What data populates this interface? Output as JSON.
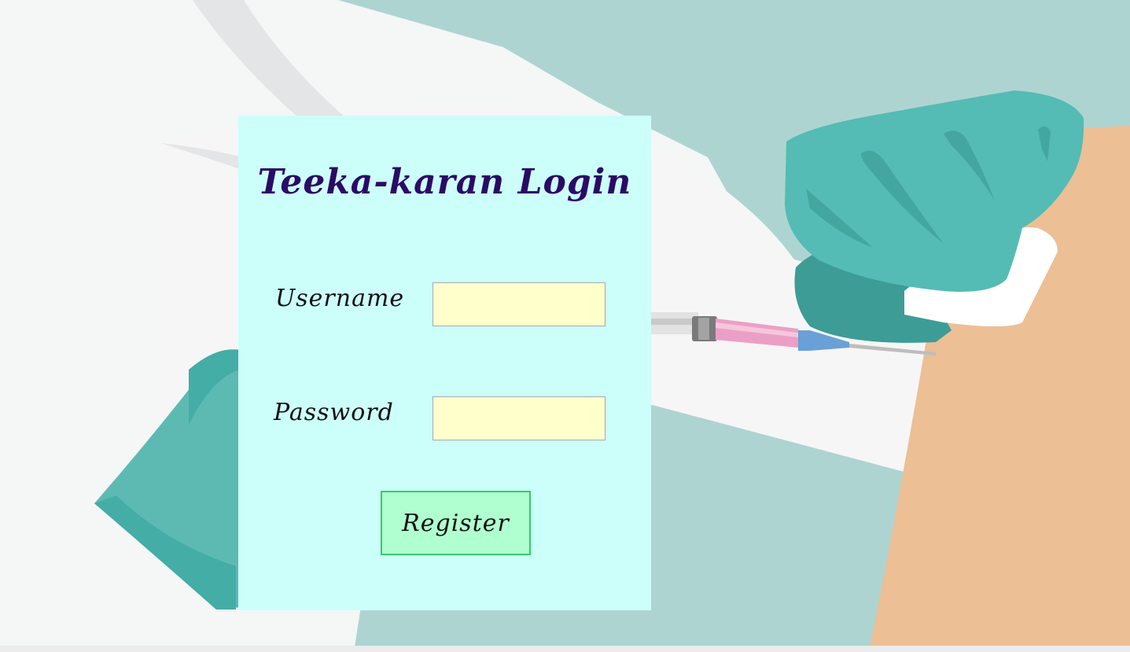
{
  "login": {
    "title": "Teeka-karan Login",
    "username_label": "Username",
    "password_label": "Password",
    "username_value": "",
    "password_value": "",
    "register_label": "Register"
  },
  "colors": {
    "card_background": "#ccfffa",
    "title_color": "#2b0a66",
    "input_background": "#ffffcc",
    "button_background": "#b0ffd0",
    "button_border": "#33cc66",
    "glove_teal": "#54bcb4",
    "background_teal": "#aed4d2",
    "arm_skin": "#ecbf95"
  },
  "illustration": {
    "subject": "gloved-hand-giving-vaccine-injection",
    "icons": [
      "syringe-icon",
      "glove-icon"
    ]
  }
}
